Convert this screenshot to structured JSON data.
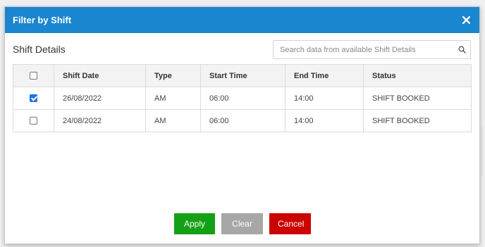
{
  "modal": {
    "title": "Filter by Shift",
    "close_icon": "close-icon"
  },
  "section": {
    "title": "Shift Details"
  },
  "search": {
    "placeholder": "Search data from available Shift Details",
    "value": "",
    "icon": "search-icon"
  },
  "table": {
    "columns": [
      "Shift Date",
      "Type",
      "Start Time",
      "End Time",
      "Status"
    ],
    "header_checkbox_checked": false,
    "rows": [
      {
        "checked": true,
        "shift_date": "26/08/2022",
        "type": "AM",
        "start_time": "06:00",
        "end_time": "14:00",
        "status": "SHIFT BOOKED"
      },
      {
        "checked": false,
        "shift_date": "24/08/2022",
        "type": "AM",
        "start_time": "06:00",
        "end_time": "14:00",
        "status": "SHIFT BOOKED"
      }
    ]
  },
  "footer": {
    "apply_label": "Apply",
    "clear_label": "Clear",
    "cancel_label": "Cancel"
  },
  "colors": {
    "header_bg": "#1a86d0",
    "apply_bg": "#14a014",
    "clear_bg": "#a7a7a7",
    "cancel_bg": "#cc0000",
    "checkbox_checked": "#1a73e8"
  }
}
